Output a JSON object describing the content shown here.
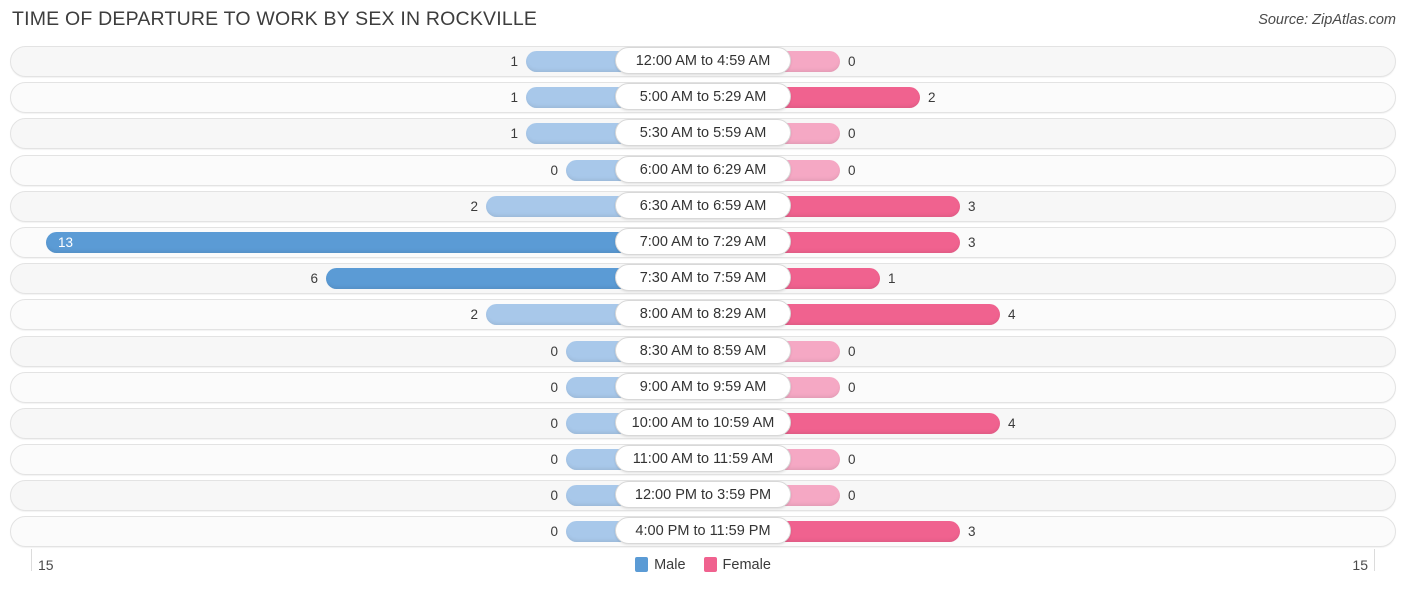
{
  "header": {
    "title": "TIME OF DEPARTURE TO WORK BY SEX IN ROCKVILLE",
    "source": "Source: ZipAtlas.com"
  },
  "legend": {
    "items": [
      {
        "label": "Male",
        "color": "#5b9bd5"
      },
      {
        "label": "Female",
        "color": "#f0628f"
      }
    ]
  },
  "axis": {
    "left_label": "15",
    "right_label": "15"
  },
  "colors": {
    "male_strong": "#5b9bd5",
    "male_light": "#a8c8ea",
    "female_strong": "#f0628f",
    "female_light": "#f5a8c4",
    "track": "#f7f7f7",
    "track_alt": "#fbfbfb",
    "track_border": "#e3e3e3"
  },
  "chart_data": {
    "type": "bar",
    "orientation": "horizontal",
    "style": "diverging-bidirectional",
    "title": "TIME OF DEPARTURE TO WORK BY SEX IN ROCKVILLE",
    "xlabel": "",
    "ylabel": "",
    "xlim": [
      15,
      15
    ],
    "axis_max": 15,
    "grid": false,
    "legend_position": "bottom-center",
    "categories": [
      "12:00 AM to 4:59 AM",
      "5:00 AM to 5:29 AM",
      "5:30 AM to 5:59 AM",
      "6:00 AM to 6:29 AM",
      "6:30 AM to 6:59 AM",
      "7:00 AM to 7:29 AM",
      "7:30 AM to 7:59 AM",
      "8:00 AM to 8:29 AM",
      "8:30 AM to 8:59 AM",
      "9:00 AM to 9:59 AM",
      "10:00 AM to 10:59 AM",
      "11:00 AM to 11:59 AM",
      "12:00 PM to 3:59 PM",
      "4:00 PM to 11:59 PM"
    ],
    "series": [
      {
        "name": "Male",
        "values": [
          1,
          1,
          1,
          0,
          2,
          13,
          6,
          2,
          0,
          0,
          0,
          0,
          0,
          0
        ]
      },
      {
        "name": "Female",
        "values": [
          0,
          2,
          0,
          0,
          3,
          3,
          1,
          4,
          0,
          0,
          4,
          0,
          0,
          3
        ]
      }
    ]
  },
  "rows": [
    {
      "label": "12:00 AM to 4:59 AM",
      "male": "1",
      "female": "0"
    },
    {
      "label": "5:00 AM to 5:29 AM",
      "male": "1",
      "female": "2"
    },
    {
      "label": "5:30 AM to 5:59 AM",
      "male": "1",
      "female": "0"
    },
    {
      "label": "6:00 AM to 6:29 AM",
      "male": "0",
      "female": "0"
    },
    {
      "label": "6:30 AM to 6:59 AM",
      "male": "2",
      "female": "3"
    },
    {
      "label": "7:00 AM to 7:29 AM",
      "male": "13",
      "female": "3"
    },
    {
      "label": "7:30 AM to 7:59 AM",
      "male": "6",
      "female": "1"
    },
    {
      "label": "8:00 AM to 8:29 AM",
      "male": "2",
      "female": "4"
    },
    {
      "label": "8:30 AM to 8:59 AM",
      "male": "0",
      "female": "0"
    },
    {
      "label": "9:00 AM to 9:59 AM",
      "male": "0",
      "female": "0"
    },
    {
      "label": "10:00 AM to 10:59 AM",
      "male": "0",
      "female": "4"
    },
    {
      "label": "11:00 AM to 11:59 AM",
      "male": "0",
      "female": "0"
    },
    {
      "label": "12:00 PM to 3:59 PM",
      "male": "0",
      "female": "0"
    },
    {
      "label": "4:00 PM to 11:59 PM",
      "male": "0",
      "female": "3"
    }
  ]
}
